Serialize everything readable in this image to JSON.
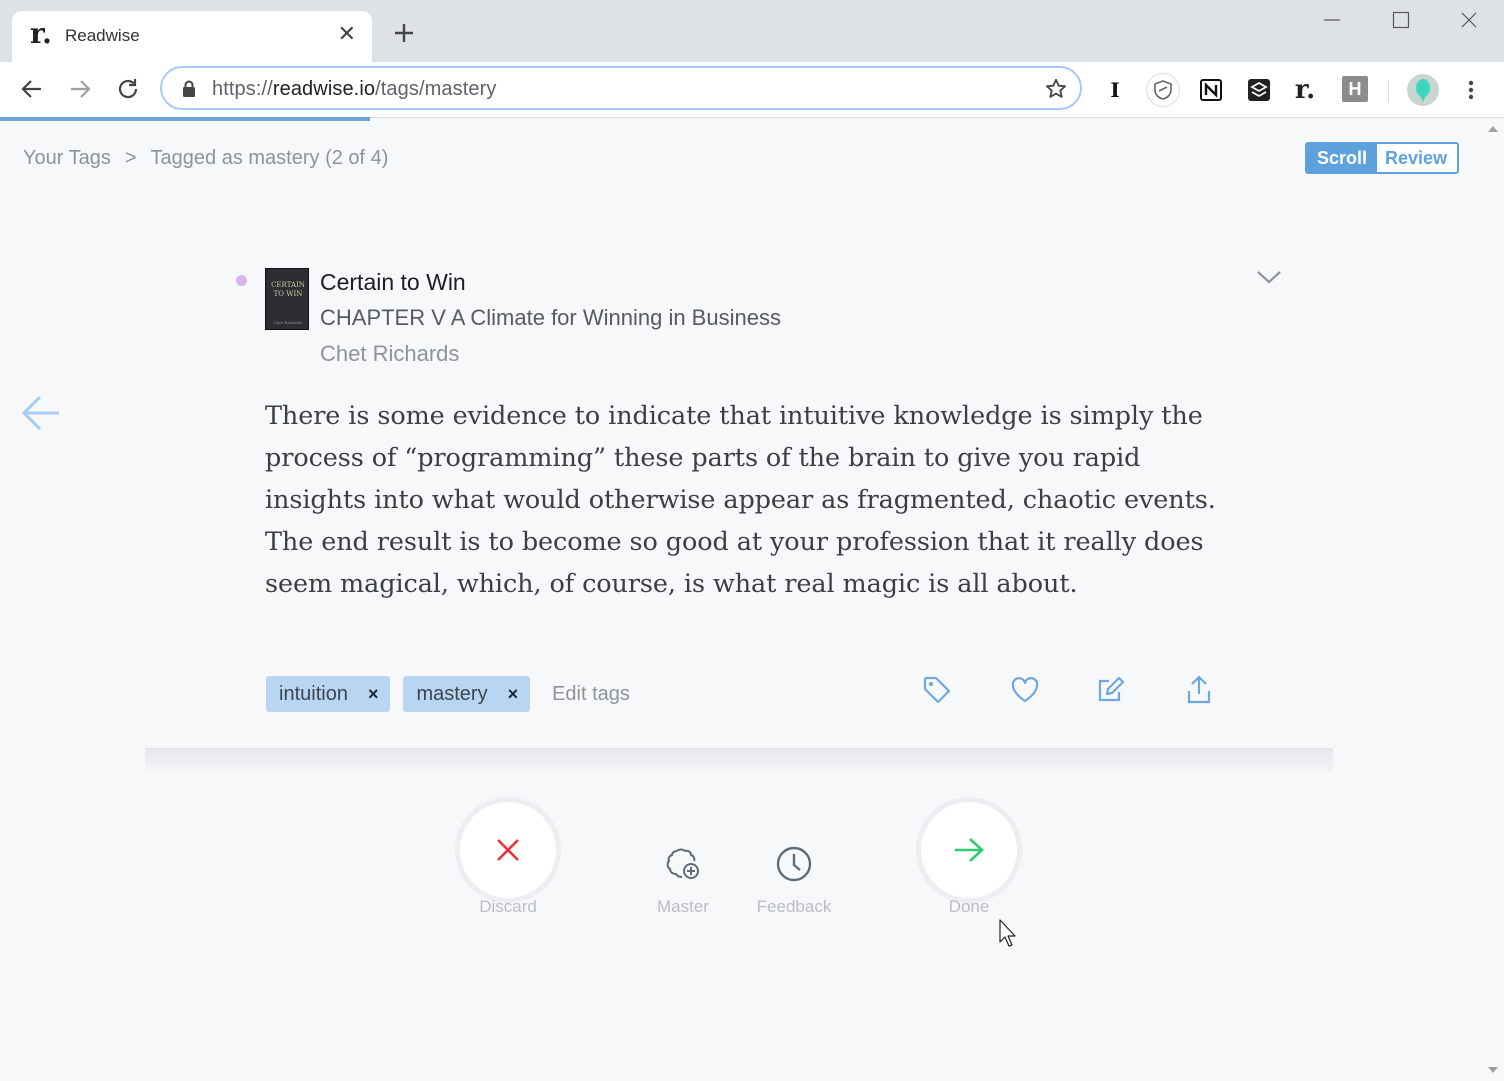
{
  "browser": {
    "tab_title": "Readwise",
    "tab_favicon": "r.",
    "url_prefix": "https://",
    "url_domain": "readwise.io",
    "url_path": "/tags/mastery",
    "extensions": [
      {
        "name": "instapaper-extension-icon",
        "glyph": "I"
      },
      {
        "name": "shield-extension-icon",
        "glyph": ""
      },
      {
        "name": "notion-extension-icon",
        "glyph": "N"
      },
      {
        "name": "layers-extension-icon",
        "glyph": ""
      },
      {
        "name": "readwise-extension-icon",
        "glyph": "r."
      },
      {
        "name": "hypothesis-extension-icon",
        "glyph": "H"
      }
    ]
  },
  "breadcrumb": {
    "root": "Your Tags",
    "separator": ">",
    "current": "Tagged as mastery (2 of 4)"
  },
  "mode_toggle": {
    "scroll": "Scroll",
    "review": "Review"
  },
  "card": {
    "cover_title": "CERTAIN TO WIN",
    "cover_author": "Chet Richards",
    "book_title": "Certain to Win",
    "chapter": "CHAPTER V A Climate for Winning in Business",
    "author": "Chet Richards",
    "highlight": "There is some evidence to indicate that intuitive knowledge is simply the process of “programming” these parts of the brain to give you rapid insights into what would otherwise appear as fragmented, chaotic events. The end result is to become so good at your profession that it really does seem magical, which, of course, is what real magic is all about.",
    "tags": [
      "intuition",
      "mastery"
    ],
    "tag_remove": "×",
    "edit_tags": "Edit tags"
  },
  "actions": {
    "discard": "Discard",
    "master": "Master",
    "feedback": "Feedback",
    "done": "Done"
  },
  "colors": {
    "accent": "#5ea2dd",
    "discard": "#e8333c",
    "done": "#2ecc71",
    "tag_bg": "#b8d5f2",
    "icon_blue": "#6fa8dc"
  }
}
